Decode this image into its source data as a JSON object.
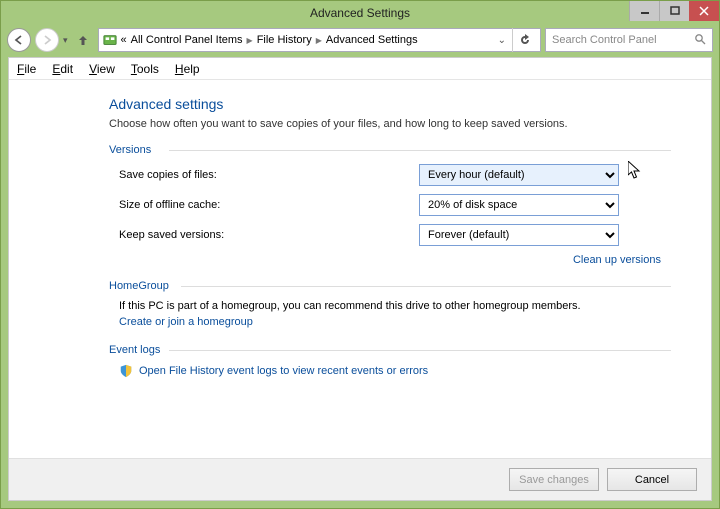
{
  "window": {
    "title": "Advanced Settings"
  },
  "breadcrumb": [
    "All Control Panel Items",
    "File History",
    "Advanced Settings"
  ],
  "search": {
    "placeholder": "Search Control Panel"
  },
  "menu": {
    "file": "File",
    "edit": "Edit",
    "view": "View",
    "tools": "Tools",
    "help": "Help"
  },
  "heading": "Advanced settings",
  "description": "Choose how often you want to save copies of your files, and how long to keep saved versions.",
  "groups": {
    "versions": {
      "label": "Versions",
      "save_copies_label": "Save copies of files:",
      "save_copies_value": "Every hour (default)",
      "offline_cache_label": "Size of offline cache:",
      "offline_cache_value": "20% of disk space",
      "keep_versions_label": "Keep saved versions:",
      "keep_versions_value": "Forever (default)",
      "cleanup_link": "Clean up versions"
    },
    "homegroup": {
      "label": "HomeGroup",
      "text": "If this PC is part of a homegroup, you can recommend this drive to other homegroup members.",
      "link": "Create or join a homegroup"
    },
    "eventlogs": {
      "label": "Event logs",
      "link": "Open File History event logs to view recent events or errors"
    }
  },
  "footer": {
    "save": "Save changes",
    "cancel": "Cancel"
  }
}
